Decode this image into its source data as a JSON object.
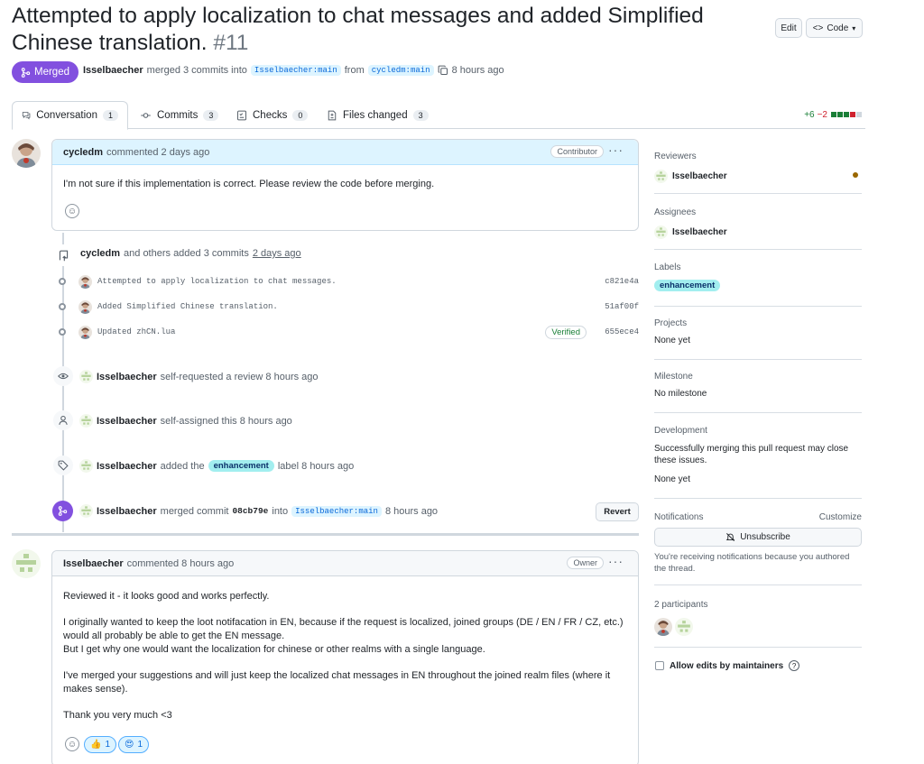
{
  "header": {
    "title": "Attempted to apply localization to chat messages and added Simplified Chinese translation.",
    "number": "#11",
    "edit_label": "Edit",
    "code_label": "Code"
  },
  "status": {
    "badge": "Merged",
    "merger": "Isselbaecher",
    "merged_text": "merged 3 commits into",
    "base_branch": "Isselbaecher:main",
    "from_text": "from",
    "head_branch": "cycledm:main",
    "time": "8 hours ago"
  },
  "tabs": [
    {
      "label": "Conversation",
      "count": "1"
    },
    {
      "label": "Commits",
      "count": "3"
    },
    {
      "label": "Checks",
      "count": "0"
    },
    {
      "label": "Files changed",
      "count": "3"
    }
  ],
  "diffstat": {
    "additions": "+6",
    "deletions": "−2"
  },
  "first_comment": {
    "author": "cycledm",
    "meta": "commented 2 days ago",
    "role": "Contributor",
    "body": "I'm not sure if this implementation is correct. Please review the code before merging."
  },
  "commits_event": {
    "author": "cycledm",
    "text": "and others added 3 commits",
    "time": "2 days ago",
    "commits": [
      {
        "message": "Attempted to apply localization to chat messages.",
        "sha": "c821e4a",
        "verified": ""
      },
      {
        "message": "Added Simplified Chinese translation.",
        "sha": "51af00f",
        "verified": ""
      },
      {
        "message": "Updated zhCN.lua",
        "sha": "655ece4",
        "verified": "Verified"
      }
    ]
  },
  "events": {
    "review": {
      "actor": "Isselbaecher",
      "text": "self-requested a review 8 hours ago"
    },
    "assign": {
      "actor": "Isselbaecher",
      "text": "self-assigned this 8 hours ago"
    },
    "label": {
      "actor": "Isselbaecher",
      "pre": "added the",
      "label": "enhancement",
      "post": "label 8 hours ago"
    },
    "merge": {
      "actor": "Isselbaecher",
      "pre": "merged commit",
      "sha": "08cb79e",
      "into": "into",
      "branch": "Isselbaecher:main",
      "time": "8 hours ago",
      "revert_label": "Revert"
    }
  },
  "second_comment": {
    "author": "Isselbaecher",
    "meta": "commented 8 hours ago",
    "role": "Owner",
    "p1": "Reviewed it - it looks good and works perfectly.",
    "p2a": "I originally wanted to keep the loot notifacation in EN, because if the request is localized, joined groups (DE / EN / FR / CZ, etc.) would all probably be able to get the EN message.",
    "p2b": "But I get why one would want the localization for chinese or other realms with a single language.",
    "p3": "I've merged your suggestions and will just keep the localized chat messages in EN throughout the joined realm files (where it makes sense).",
    "p4": "Thank you very much <3",
    "reactions": [
      {
        "emoji": "👍",
        "count": "1"
      },
      {
        "emoji": "😍",
        "count": "1"
      }
    ]
  },
  "sidebar": {
    "reviewers": {
      "heading": "Reviewers",
      "user": "Isselbaecher"
    },
    "assignees": {
      "heading": "Assignees",
      "user": "Isselbaecher"
    },
    "labels": {
      "heading": "Labels",
      "label": "enhancement"
    },
    "projects": {
      "heading": "Projects",
      "value": "None yet"
    },
    "milestone": {
      "heading": "Milestone",
      "value": "No milestone"
    },
    "development": {
      "heading": "Development",
      "text": "Successfully merging this pull request may close these issues.",
      "value": "None yet"
    },
    "notifications": {
      "heading": "Notifications",
      "customize": "Customize",
      "button": "Unsubscribe",
      "note": "You're receiving notifications because you authored the thread."
    },
    "participants": {
      "heading": "2 participants"
    },
    "allow_edits": {
      "label": "Allow edits by maintainers"
    }
  },
  "colors": {
    "merged": "#8250df",
    "accent": "#0969da",
    "additions": "#1a7f37",
    "deletions": "#cf222e",
    "label": "#a2eeef"
  }
}
